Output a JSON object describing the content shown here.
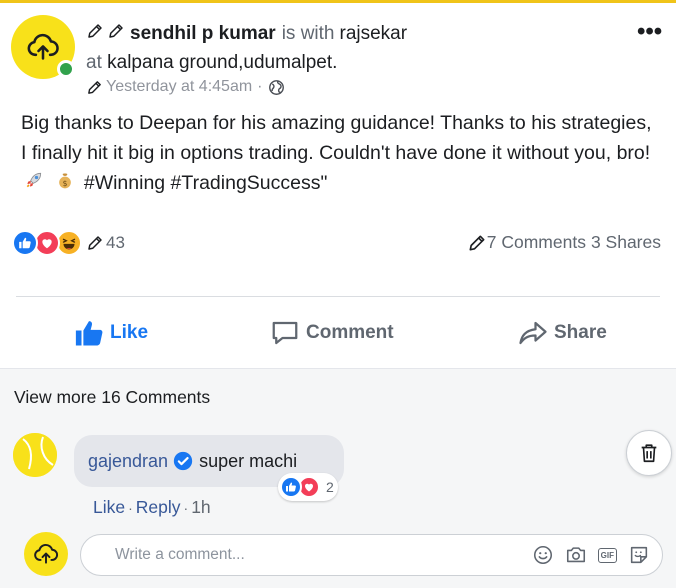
{
  "post": {
    "author": "sendhil p kumar",
    "with_text": "is with",
    "with_name": "rajsekar",
    "location_prefix": "at",
    "location": "kalpana ground,udumalpet.",
    "timestamp": "Yesterday at 4:45am",
    "separator": "·",
    "privacy_icon": "globe-icon",
    "more_label": "•••",
    "text_part1": "Big thanks to Deepan for his amazing guidance! Thanks to his strategies, I finally hit it big in options trading. Couldn't have done it without you, bro!",
    "text_part2": "#Winning #TradingSuccess\""
  },
  "stats": {
    "reaction_count": "43",
    "comments": "7 Comments",
    "shares": "3 Shares",
    "reactions": [
      "like-icon",
      "love-icon",
      "haha-icon"
    ]
  },
  "actions": {
    "like": "Like",
    "comment": "Comment",
    "share": "Share"
  },
  "comments_section": {
    "view_more": "View more 16 Comments",
    "comment": {
      "author": "gajendran",
      "text": "super machi",
      "reaction_count": "2",
      "like_action": "Like",
      "reply_action": "Reply",
      "sep": "·",
      "time": "1h"
    },
    "composer": {
      "placeholder": "Write a comment...",
      "gif_label": "GIF"
    }
  },
  "colors": {
    "accent_blue": "#1877f2",
    "link_blue": "#385898",
    "avatar_yellow": "#f8e11a",
    "online_green": "#31a24c",
    "love_red": "#f33e58",
    "haha_yellow": "#f7b125"
  }
}
